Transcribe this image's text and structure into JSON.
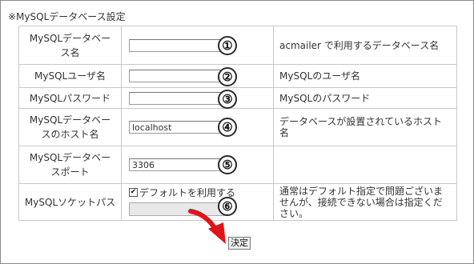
{
  "section_title": "※MySQLデータベース設定",
  "rows": [
    {
      "label": "MySQLデータベース名",
      "value": "",
      "marker": "①",
      "description": "acmailer で利用するデータベース名"
    },
    {
      "label": "MySQLユーザ名",
      "value": "",
      "marker": "②",
      "description": "MySQLのユーザ名"
    },
    {
      "label": "MySQLパスワード",
      "value": "",
      "marker": "③",
      "description": "MySQLのパスワード"
    },
    {
      "label": "MySQLデータベースのホスト名",
      "value": "localhost",
      "marker": "④",
      "description": "データベースが設置されているホスト名"
    },
    {
      "label": "MySQLデータベースポート",
      "value": "3306",
      "marker": "⑤",
      "description": ""
    }
  ],
  "socket_row": {
    "label": "MySQLソケットパス",
    "checkbox_label": "デフォルトを利用する",
    "checkbox_checked": true,
    "marker": "⑥",
    "description": "通常はデフォルト指定で問題ございませんが、接続できない場合は指定ください。"
  },
  "submit_label": "決定",
  "annotation_arrow_color": "#e0141b"
}
